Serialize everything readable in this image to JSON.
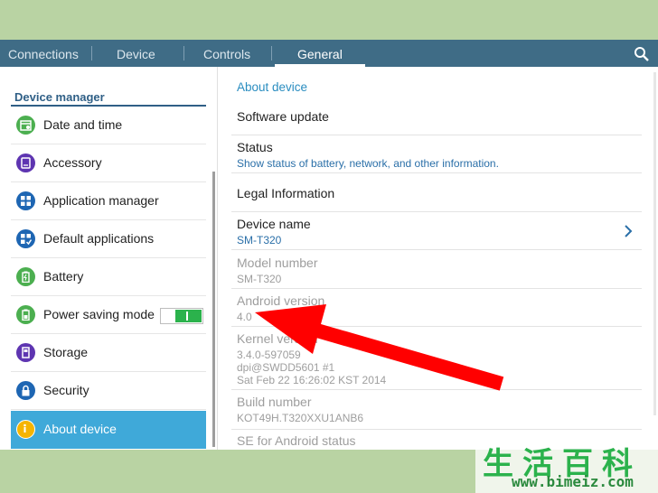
{
  "tabs": [
    {
      "label": "Connections"
    },
    {
      "label": "Device"
    },
    {
      "label": "Controls"
    },
    {
      "label": "General",
      "active": true
    }
  ],
  "sidebar": {
    "title": "Device manager",
    "items": [
      {
        "label": "Date and time",
        "icon": "clock-icon",
        "color": "#4caf50"
      },
      {
        "label": "Accessory",
        "icon": "accessory-icon",
        "color": "#5e35b1"
      },
      {
        "label": "Application manager",
        "icon": "apps-grid-icon",
        "color": "#1e66b3"
      },
      {
        "label": "Default applications",
        "icon": "default-apps-icon",
        "color": "#1e66b3"
      },
      {
        "label": "Battery",
        "icon": "battery-icon",
        "color": "#4caf50"
      },
      {
        "label": "Power saving mode",
        "icon": "power-saving-icon",
        "color": "#4caf50",
        "toggle": true
      },
      {
        "label": "Storage",
        "icon": "storage-icon",
        "color": "#5e35b1"
      },
      {
        "label": "Security",
        "icon": "lock-icon",
        "color": "#1e66b3"
      },
      {
        "label": "About device",
        "icon": "info-icon",
        "color": "#f5b400",
        "selected": true
      }
    ]
  },
  "content": {
    "header": "About device",
    "rows": [
      {
        "title": "Software update"
      },
      {
        "title": "Status",
        "sub": "Show status of battery, network, and other information."
      },
      {
        "title": "Legal Information"
      },
      {
        "title": "Device name",
        "sub": "SM-T320"
      },
      {
        "title": "Model number",
        "sub": "SM-T320"
      },
      {
        "title": "Android version",
        "sub": "4.0"
      },
      {
        "title": "Kernel version",
        "sub1": "3.4.0-597059",
        "sub2": "dpi@SWDD5601 #1",
        "sub3": "Sat Feb 22 16:26:02 KST 2014"
      },
      {
        "title": "Build number",
        "sub": "KOT49H.T320XXU1ANB6"
      },
      {
        "title": "SE for Android status"
      }
    ]
  },
  "watermark": {
    "chars": "生活百科",
    "url": "www.bimeiz.com"
  },
  "colors": {
    "tabbar": "#3f6c86",
    "accent": "#3fa9d9",
    "arrow": "#ff0000",
    "background": "#b9d3a3"
  }
}
